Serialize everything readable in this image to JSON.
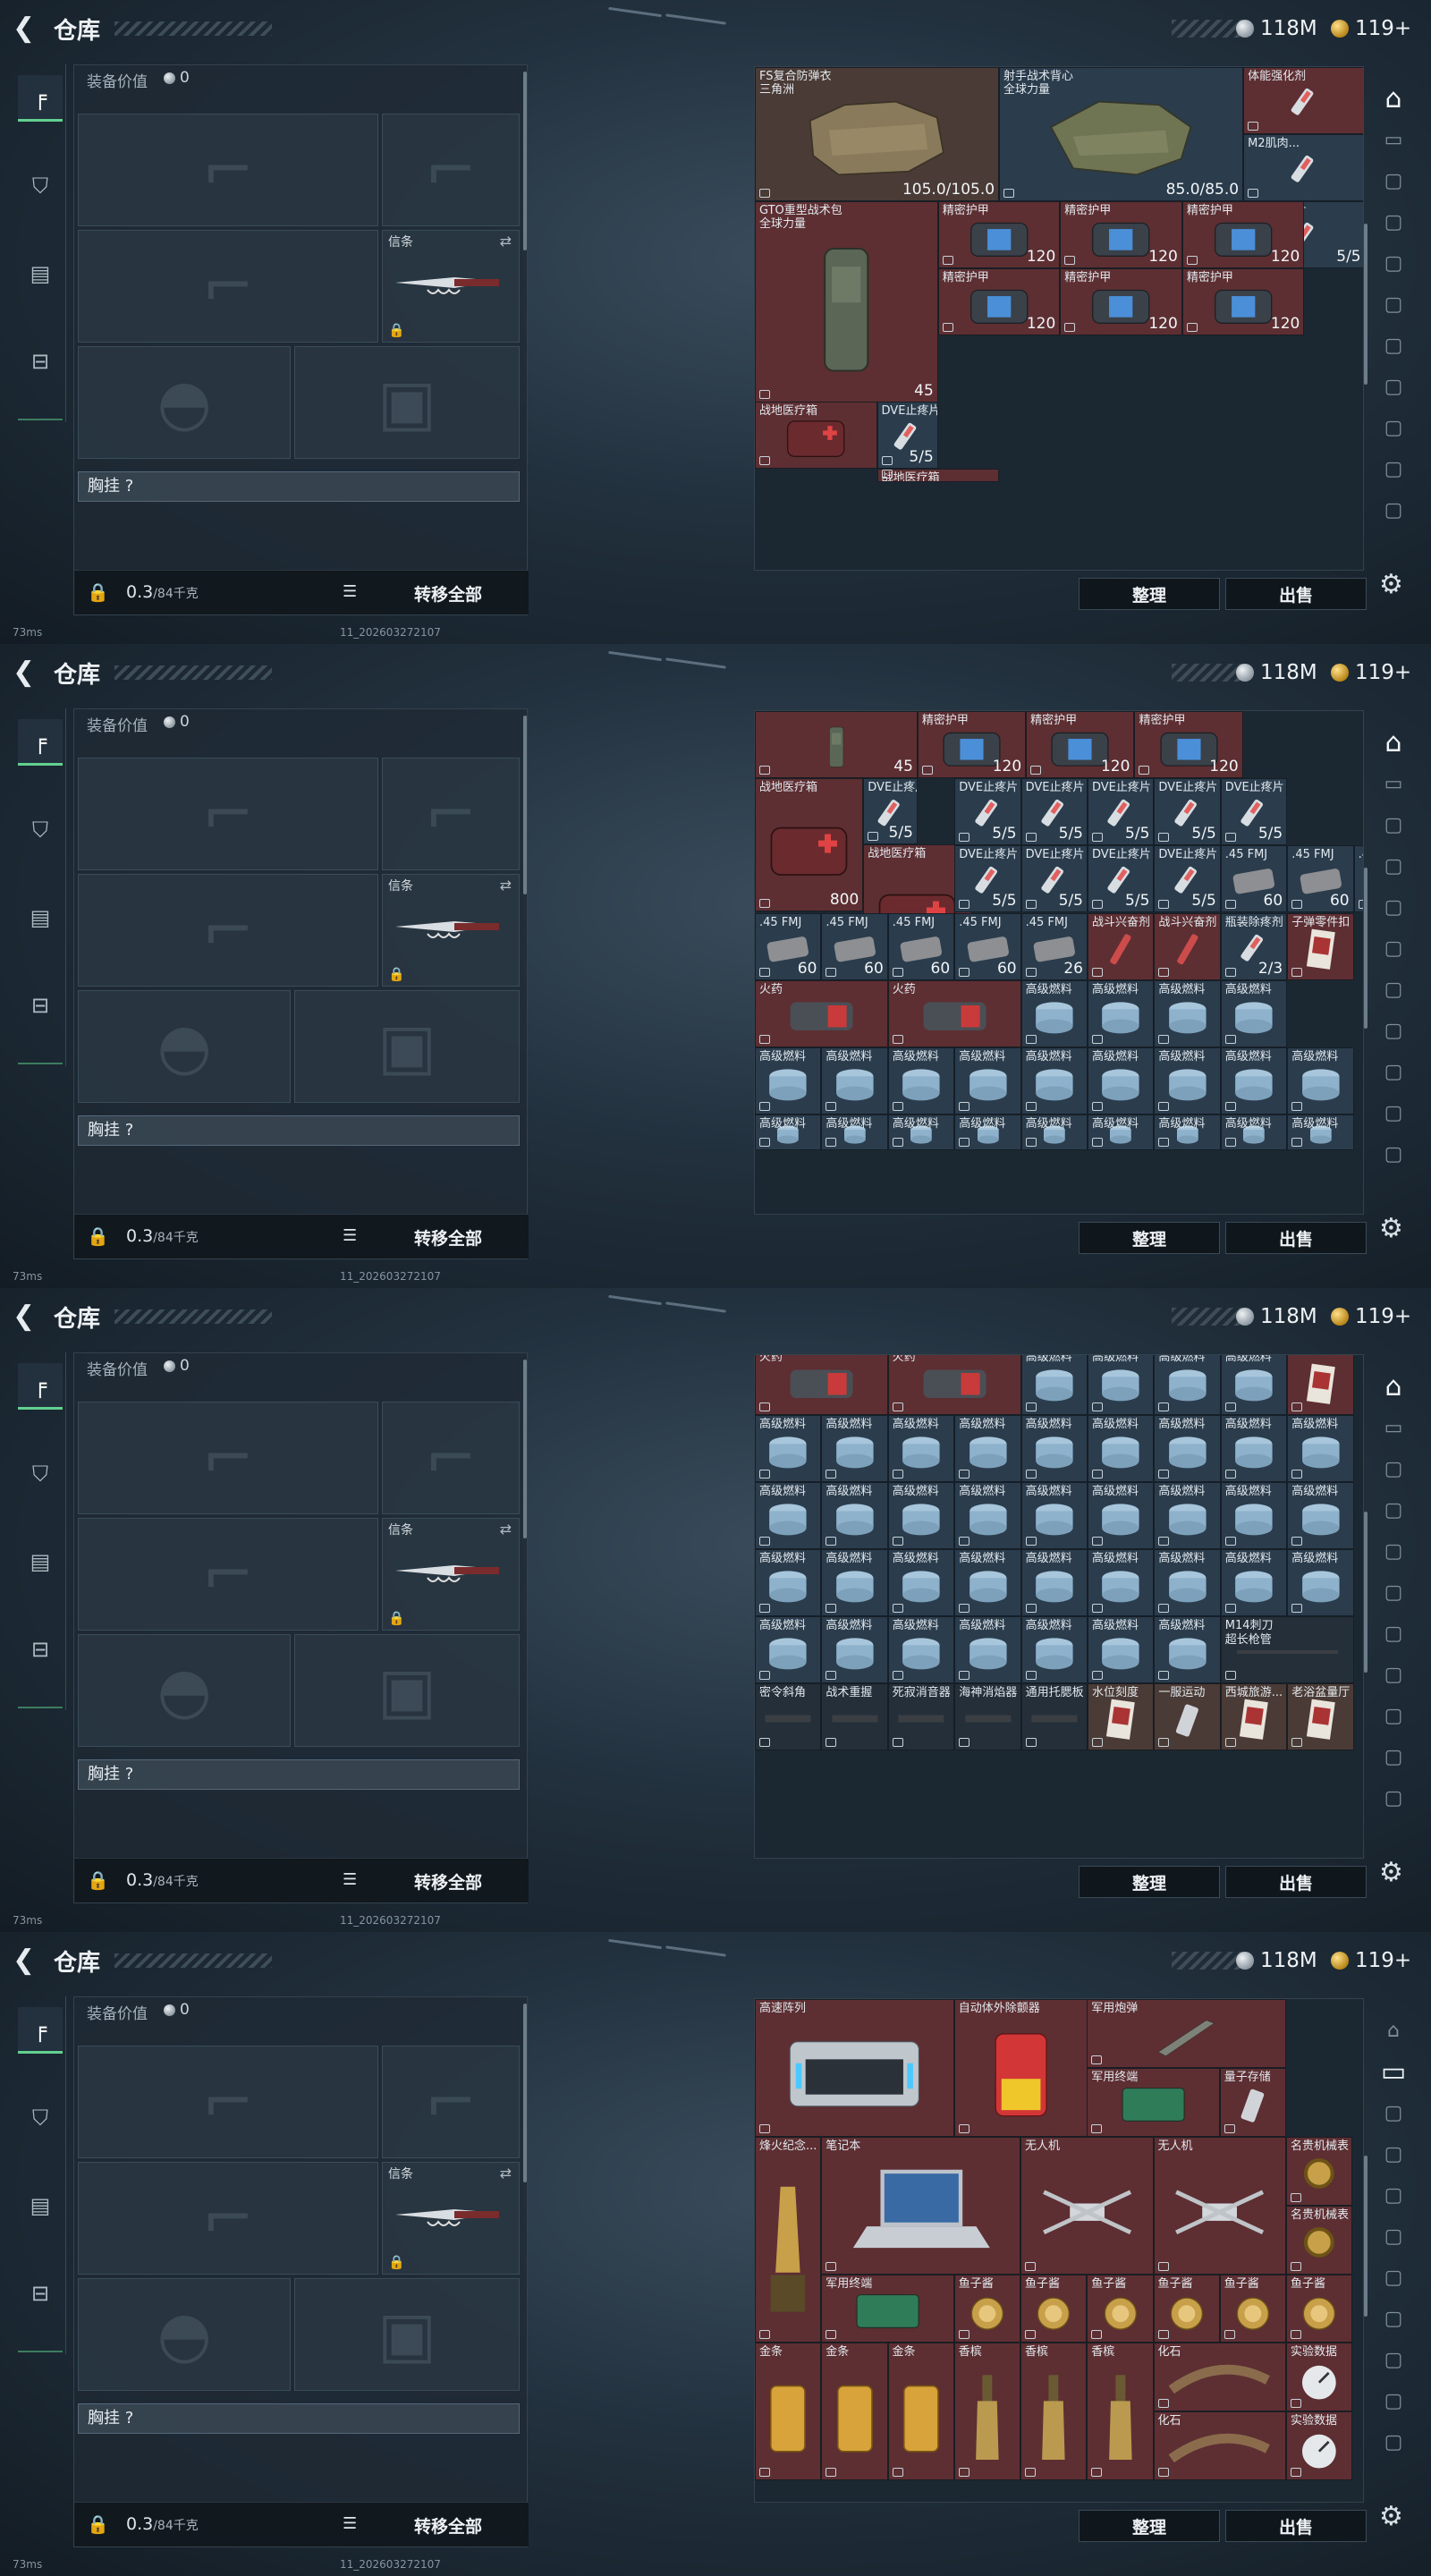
{
  "common": {
    "title": "仓库",
    "silver": "118M",
    "gold": "119+",
    "equip_label": "装备价值",
    "equip_value": "0",
    "xinxi_label": "信条",
    "chest_label": "胸挂 ?",
    "weight": "0.3",
    "weight_cap": "/84千克",
    "transfer_all": "转移全部",
    "sort": "整理",
    "sell": "出售",
    "ping": "73ms",
    "build": "11_202603272107"
  },
  "colors": {
    "accent": "#62d18f",
    "red_cell": "#5d2f33",
    "blue_cell": "#2b3d4d"
  },
  "panels": [
    {
      "active_tab": 0,
      "cells": [
        {
          "x": 0,
          "y": 0,
          "w": 2,
          "h": 2,
          "c": "tan",
          "name": "FS复合防弹衣\n三角洲",
          "val": "105.0/105.0",
          "img": "vest"
        },
        {
          "x": 2,
          "y": 0,
          "w": 2,
          "h": 2,
          "c": "blue",
          "name": "射手战术背心\n全球力量",
          "val": "85.0/85.0",
          "img": "vest2"
        },
        {
          "x": 4,
          "y": 0,
          "w": 1,
          "h": 1,
          "c": "red",
          "name": "体能强化剂",
          "val": "",
          "img": "syringe"
        },
        {
          "x": 4,
          "y": 1,
          "w": 1,
          "h": 1,
          "c": "blue",
          "name": "M2肌肉...",
          "val": "",
          "img": "syringe"
        },
        {
          "x": 4,
          "y": 2,
          "w": 1,
          "h": 1,
          "c": "blue",
          "name": "DVE止疼片",
          "val": "5/5",
          "img": "syringe"
        },
        {
          "x": 0,
          "y": 2,
          "w": 1.5,
          "h": 3,
          "c": "red",
          "name": "GTO重型战术包\n全球力量",
          "val": "45",
          "img": "bag"
        },
        {
          "x": 1.5,
          "y": 2,
          "w": 1,
          "h": 1,
          "c": "red",
          "name": "精密护甲",
          "val": "120",
          "img": "kit"
        },
        {
          "x": 2.5,
          "y": 2,
          "w": 1,
          "h": 1,
          "c": "red",
          "name": "精密护甲",
          "val": "120",
          "img": "kit"
        },
        {
          "x": 3.5,
          "y": 2,
          "w": 1,
          "h": 1,
          "c": "red",
          "name": "精密护甲",
          "val": "120",
          "img": "kit"
        },
        {
          "x": 1.5,
          "y": 3,
          "w": 1,
          "h": 1,
          "c": "red",
          "name": "精密护甲",
          "val": "120",
          "img": "kit"
        },
        {
          "x": 2.5,
          "y": 3,
          "w": 1,
          "h": 1,
          "c": "red",
          "name": "精密护甲",
          "val": "120",
          "img": "kit"
        },
        {
          "x": 3.5,
          "y": 3,
          "w": 1,
          "h": 1,
          "c": "red",
          "name": "精密护甲",
          "val": "120",
          "img": "kit"
        },
        {
          "x": 0,
          "y": 5,
          "w": 1,
          "h": 1,
          "c": "red",
          "name": "战地医疗箱",
          "val": "",
          "img": "med"
        },
        {
          "x": 1,
          "y": 5,
          "w": 0.5,
          "h": 1,
          "c": "blue",
          "name": "DVE止疼片",
          "val": "5/5",
          "img": "syringe"
        },
        {
          "x": 1,
          "y": 6,
          "w": 1,
          "h": 0.2,
          "c": "red",
          "name": "战地医疗箱",
          "val": "",
          "img": ""
        }
      ]
    },
    {
      "active_tab": 0,
      "cells": [
        {
          "x": 0,
          "y": 0,
          "w": 1.5,
          "h": 1,
          "c": "red",
          "name": "",
          "val": "45",
          "img": "bag"
        },
        {
          "x": 1.5,
          "y": 0,
          "w": 1,
          "h": 1,
          "c": "red",
          "name": "精密护甲",
          "val": "120",
          "img": "kit"
        },
        {
          "x": 2.5,
          "y": 0,
          "w": 1,
          "h": 1,
          "c": "red",
          "name": "精密护甲",
          "val": "120",
          "img": "kit"
        },
        {
          "x": 3.5,
          "y": 0,
          "w": 1,
          "h": 1,
          "c": "red",
          "name": "精密护甲",
          "val": "120",
          "img": "kit"
        },
        {
          "x": 0,
          "y": 1,
          "w": 1,
          "h": 2,
          "c": "red",
          "name": "战地医疗箱",
          "val": "800",
          "img": "med"
        },
        {
          "x": 1,
          "y": 1,
          "w": 0.5,
          "h": 1,
          "c": "blue",
          "name": "DVE止疼片",
          "val": "5/5",
          "img": "syringe"
        },
        {
          "x": 1,
          "y": 2,
          "w": 1,
          "h": 2,
          "c": "red",
          "name": "战地医疗箱",
          "val": "800",
          "img": "med"
        },
        {
          "x": 2,
          "y": 2,
          "w": 0.5,
          "h": 1,
          "c": "blue",
          "name": "DVE止疼片",
          "val": "5/5",
          "img": "syringe"
        }
      ]
    },
    {
      "active_tab": 0,
      "cells": []
    },
    {
      "active_tab": 1,
      "cells": []
    }
  ],
  "grid2": {
    "rows": [
      [
        "DVE止疼片",
        "DVE止疼片",
        "DVE止疼片",
        "DVE止疼片",
        "DVE止疼片"
      ],
      [
        "DVE止疼片",
        "DVE止疼片",
        "DVE止疼片",
        "DVE止疼片",
        ".45 FMJ",
        ".45 FMJ",
        ".45 FMJ"
      ],
      [
        ".45 FMJ",
        ".45 FMJ",
        ".45 FMJ",
        ".45 FMJ",
        ".45 FMJ",
        "战斗兴奋剂",
        "战斗兴奋剂",
        "瓶装除疼剂",
        "子弹零件扣"
      ],
      [
        "火药",
        "火药",
        "高级燃料",
        "高级燃料",
        "高级燃料",
        "高级燃料"
      ],
      [
        "高级燃料",
        "高级燃料",
        "高级燃料",
        "高级燃料",
        "高级燃料",
        "高级燃料",
        "高级燃料",
        "高级燃料",
        "高级燃料"
      ]
    ],
    "vals": [
      [
        "5/5",
        "5/5",
        "5/5",
        "5/5",
        "5/5"
      ],
      [
        "5/5",
        "5/5",
        "5/5",
        "5/5",
        "60",
        "60",
        "60"
      ],
      [
        "60",
        "60",
        "60",
        "60",
        "26",
        "",
        "",
        "2/3",
        ""
      ],
      [
        "",
        "",
        "",
        "",
        "",
        ""
      ],
      [
        "",
        "",
        "",
        "",
        "",
        "",
        "",
        "",
        ""
      ]
    ]
  },
  "grid3": {
    "fuel": "高级燃料",
    "gunpowder": "火药",
    "extra_rows": [
      [
        "M14刺刀",
        "超长枪管"
      ],
      [
        "密令斜角",
        "战术重握",
        "死寂消音器",
        "海神消焰器",
        "通用托腮板",
        "水位刻度",
        "一服运动",
        "西城旅游...",
        "老浴盆量厅"
      ]
    ]
  },
  "grid4": {
    "items": [
      {
        "name": "高速阵列"
      },
      {
        "name": "自动体外除颤器"
      },
      {
        "name": "军用炮弹"
      },
      {
        "name": "军用终端"
      },
      {
        "name": "量子存储"
      },
      {
        "name": "烽火纪念..."
      },
      {
        "name": "笔记本"
      },
      {
        "name": "无人机"
      },
      {
        "name": "无人机"
      },
      {
        "name": "名贵机械表"
      },
      {
        "name": "名贵机械表"
      },
      {
        "name": "军用终端"
      },
      {
        "name": "鱼子酱"
      },
      {
        "name": "鱼子酱"
      },
      {
        "name": "鱼子酱"
      },
      {
        "name": "鱼子酱"
      },
      {
        "name": "鱼子酱"
      },
      {
        "name": "鱼子酱"
      },
      {
        "name": "金条"
      },
      {
        "name": "金条"
      },
      {
        "name": "金条"
      },
      {
        "name": "香槟"
      },
      {
        "name": "香槟"
      },
      {
        "name": "香槟"
      },
      {
        "name": "化石"
      },
      {
        "name": "实验数据"
      },
      {
        "name": "化石"
      },
      {
        "name": "实验数据"
      }
    ]
  }
}
